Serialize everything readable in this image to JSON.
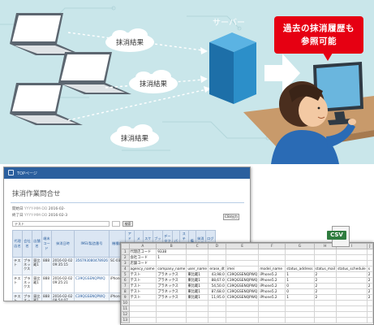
{
  "diagram": {
    "server_label": "サーバー",
    "sync_label": "抹消結果",
    "speech_lines": [
      "過去の抹消履歴も",
      "参照可能"
    ]
  },
  "browser": {
    "breadcrumb": "TOPページ",
    "page_title": "抹消作業問合せ",
    "start_label": "開始日",
    "start_placeholder": "YYYY-MM-DD",
    "start_value": "2016-02-",
    "end_label": "終了日",
    "end_placeholder": "YYYY-MM-DD",
    "end_value": "2016-02-3",
    "search_select": "テスト",
    "search_button": "検索",
    "export_button": "CSV出力",
    "headers": [
      "代理店名",
      "会社名",
      "店舗名",
      "端末コード",
      "抹消日時",
      "IMEI/製造番号",
      "機種名",
      "アドレス帳",
      "メール",
      "スケジュール",
      "ブックマーク",
      "データフォルダ",
      "パス",
      "ステータス",
      "備考",
      "抹消作業メモ",
      "ログタイプ"
    ],
    "rows": [
      [
        "テスト",
        "プラネックス",
        "東比蔵1",
        "888",
        "2016-02-02 09:35:15",
        "356793080478926",
        "SC-03"
      ],
      [
        "テスト",
        "プラネックス",
        "東比蔵1",
        "888",
        "2016-02-02 09:25:21",
        "C39QGSENQPWQ",
        "iPhone6"
      ],
      [
        "テスト",
        "プラネックス",
        "東比蔵1",
        "888",
        "2016-02-02 08:54:07",
        "C39QGSENQPWQ",
        "iPhone6"
      ],
      [
        "テスト",
        "プラネックス",
        "東比蔵1",
        "888",
        "2016-02-02 08:48:41",
        "C39QGSENQPWQ",
        "iPhone6"
      ]
    ]
  },
  "csv": {
    "icon_label": "CSV",
    "columns": [
      "A",
      "B",
      "C",
      "D",
      "E",
      "F",
      "G",
      "H",
      "I",
      "J"
    ],
    "meta": [
      [
        "代理店コード",
        "9338"
      ],
      [
        "会社コード",
        "1"
      ],
      [
        "店舗コード",
        ""
      ]
    ],
    "headers": [
      "agency_name",
      "company_name",
      "user_name",
      "erase_dt",
      "imei",
      "model_name",
      "status_address",
      "status_mail",
      "status_schedule",
      "s"
    ],
    "rows": [
      [
        "テスト",
        "プラネックス",
        "東比蔵1",
        "43,98.0",
        "C39QGSENQPWQ",
        "iPhone5.2",
        "1",
        "2",
        "",
        "2"
      ],
      [
        "テスト",
        "プラネックス",
        "東比蔵1",
        "88,67.0",
        "C39QGSENQPWQ",
        "iPhone5.2",
        "1",
        "2",
        "",
        "2"
      ],
      [
        "テスト",
        "プラネックス",
        "東比蔵1",
        "54,50.0",
        "C39QGSENQPWQ",
        "iPhone5.2",
        "0",
        "2",
        "",
        "2"
      ],
      [
        "テスト",
        "プラネックス",
        "東比蔵1",
        "87,68.0",
        "C39QGSENQPWQ",
        "iPhone5.2",
        "0",
        "2",
        "",
        "2"
      ],
      [
        "テスト",
        "プラネックス",
        "東比蔵1",
        "11,95.0",
        "C39QGSENQPWQ",
        "iPhone5.2",
        "1",
        "2",
        "",
        "2"
      ]
    ]
  },
  "colors": {
    "background": "#c9e6ea",
    "server": "#2c8fc9",
    "accent": "#e60012",
    "arrow": "#ffffff"
  }
}
